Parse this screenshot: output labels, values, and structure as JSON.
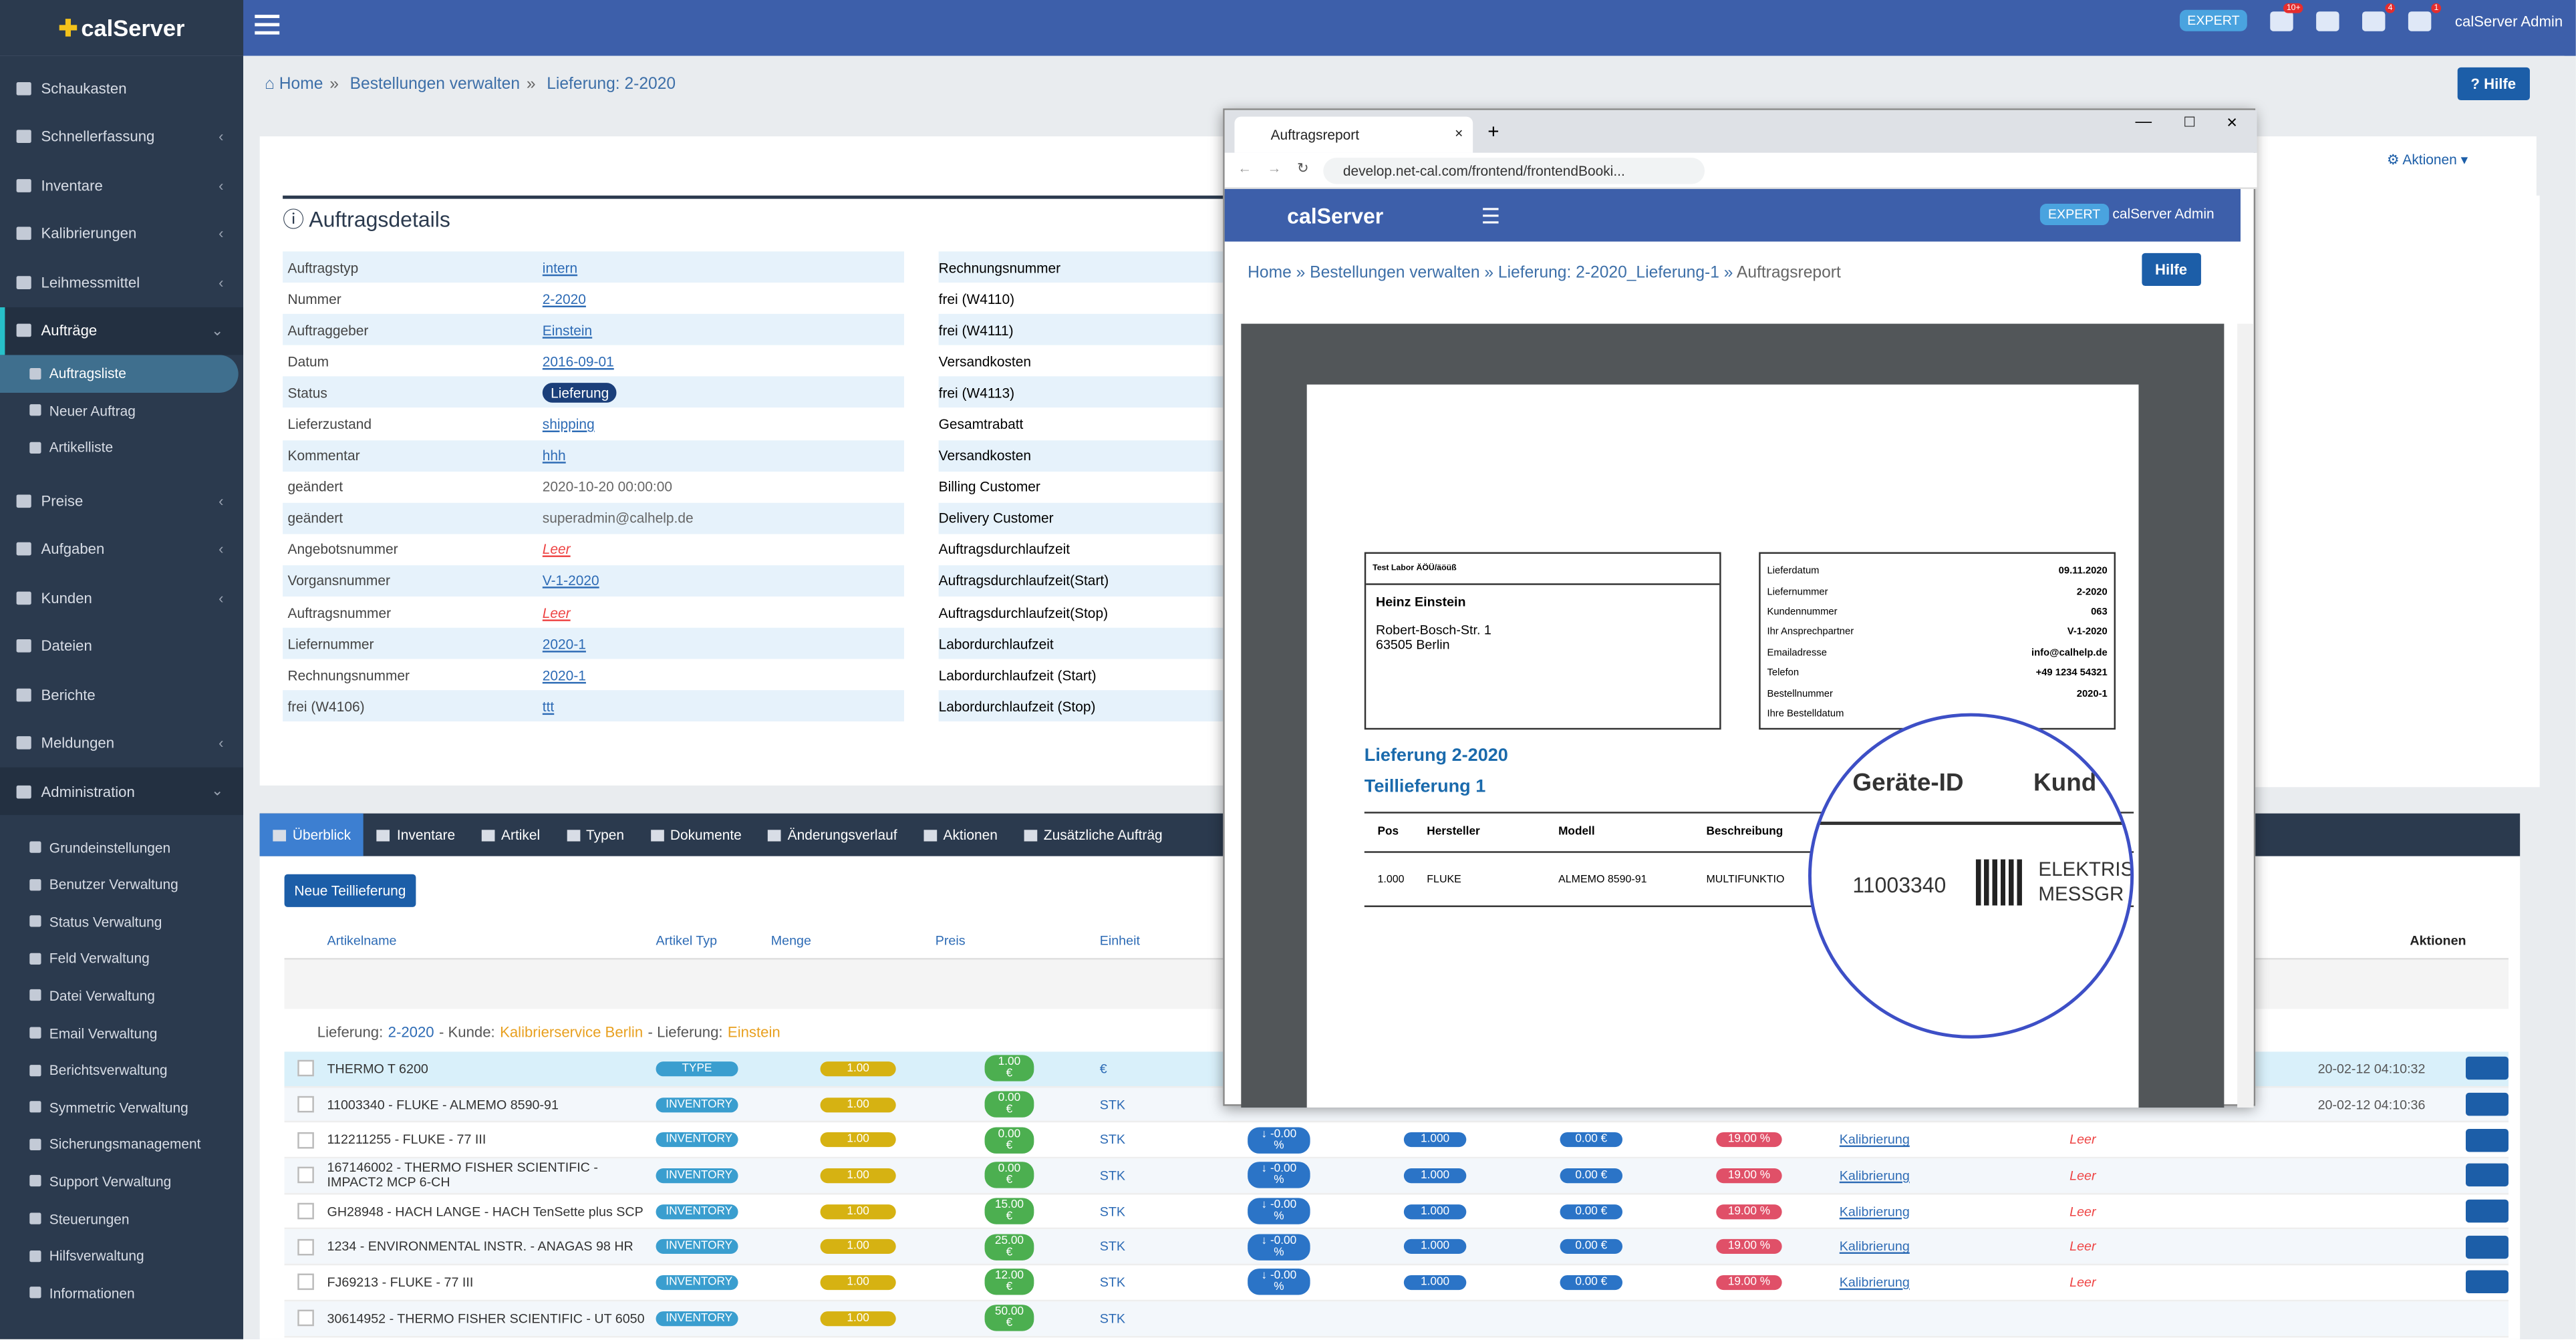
{
  "app": {
    "name": "calServer"
  },
  "topbar": {
    "expert": "EXPERT",
    "user": "calServer Admin",
    "badges": [
      "10+",
      "4",
      "1"
    ]
  },
  "sidebar": {
    "items": [
      "Schaukasten",
      "Schnellerfassung",
      "Inventare",
      "Kalibrierungen",
      "Leihmessmittel",
      "Aufträge"
    ],
    "auftraege_sub": [
      "Auftragsliste",
      "Neuer Auftrag",
      "Artikelliste"
    ],
    "items2": [
      "Preise",
      "Aufgaben",
      "Kunden",
      "Dateien",
      "Berichte",
      "Meldungen",
      "Administration"
    ],
    "admin_sub": [
      "Grundeinstellungen",
      "Benutzer Verwaltung",
      "Status Verwaltung",
      "Feld Verwaltung",
      "Datei Verwaltung",
      "Email Verwaltung",
      "Berichtsverwaltung",
      "Symmetric Verwaltung",
      "Sicherungsmanagement",
      "Support Verwaltung",
      "Steuerungen",
      "Hilfsverwaltung",
      "Informationen"
    ]
  },
  "breadcrumb": {
    "home": "Home",
    "b1": "Bestellungen verwalten",
    "b2": "Lieferung: 2-2020"
  },
  "hilfe": "Hilfe",
  "details": {
    "title": "Auftragsdetails",
    "left": [
      {
        "k": "Auftragstyp",
        "v": "intern"
      },
      {
        "k": "Nummer",
        "v": "2-2020"
      },
      {
        "k": "Auftraggeber",
        "v": "Einstein"
      },
      {
        "k": "Datum",
        "v": "2016-09-01"
      },
      {
        "k": "Status",
        "v": "Lieferung"
      },
      {
        "k": "Lieferzustand",
        "v": "shipping"
      },
      {
        "k": "Kommentar",
        "v": "hhh"
      },
      {
        "k": "geändert",
        "v": "2020-10-20 00:00:00"
      },
      {
        "k": "geändert",
        "v": "superadmin@calhelp.de"
      },
      {
        "k": "Angebotsnummer",
        "v": "Leer"
      },
      {
        "k": "Vorgansnummer",
        "v": "V-1-2020"
      },
      {
        "k": "Auftragsnummer",
        "v": "Leer"
      },
      {
        "k": "Liefernummer",
        "v": "2020-1"
      },
      {
        "k": "Rechnungsnummer",
        "v": "2020-1"
      },
      {
        "k": "frei (W4106)",
        "v": "ttt"
      }
    ],
    "right": [
      "Rechnungsnummer",
      "frei (W4110)",
      "frei (W4111)",
      "Versandkosten",
      "frei (W4113)",
      "Gesamtrabatt",
      "Versandkosten",
      "Billing Customer",
      "Delivery Customer",
      "Auftragsdurchlaufzeit",
      "Auftragsdurchlaufzeit(Start)",
      "Auftragsdurchlaufzeit(Stop)",
      "Labordurchlaufzeit",
      "Labordurchlaufzeit (Start)",
      "Labordurchlaufzeit (Stop)"
    ]
  },
  "tabs": [
    "Überblick",
    "Inventare",
    "Artikel",
    "Typen",
    "Dokumente",
    "Änderungsverlauf",
    "Aktionen",
    "Zusätzliche Aufträg"
  ],
  "neu": "Neue Teillieferung",
  "cols": [
    "Artikelname",
    "Artikel Typ",
    "Menge",
    "Preis",
    "Einheit"
  ],
  "aktionen": "Aktionen",
  "lief": {
    "p1": "Lieferung:",
    "no": "2-2020",
    "p2": "- Kunde:",
    "kunde": "Kalibrierservice Berlin",
    "p3": "- Lieferung:",
    "wer": "Einstein"
  },
  "rows": [
    {
      "name": "THERMO T 6200",
      "type": "TYPE",
      "menge": "1.00",
      "preis": "1.00 €",
      "einheit": "€"
    },
    {
      "name": "11003340 - FLUKE - ALMEMO 8590-91",
      "type": "INVENTORY",
      "menge": "1.00",
      "preis": "0.00 €",
      "einheit": "STK"
    },
    {
      "name": "112211255 - FLUKE - 77 III",
      "type": "INVENTORY",
      "menge": "1.00",
      "preis": "0.00 €",
      "einheit": "STK"
    },
    {
      "name": "167146002 - THERMO FISHER SCIENTIFIC - IMPACT2 MCP 6-CH",
      "type": "INVENTORY",
      "menge": "1.00",
      "preis": "0.00 €",
      "einheit": "STK"
    },
    {
      "name": "GH28948 - HACH LANGE - HACH TenSette plus SCP",
      "type": "INVENTORY",
      "menge": "1.00",
      "preis": "15.00 €",
      "einheit": "STK"
    },
    {
      "name": "1234 - ENVIRONMENTAL INSTR. - ANAGAS 98 HR",
      "type": "INVENTORY",
      "menge": "1.00",
      "preis": "25.00 €",
      "einheit": "STK"
    },
    {
      "name": "FJ69213 - FLUKE - 77 III",
      "type": "INVENTORY",
      "menge": "1.00",
      "preis": "12.00 €",
      "einheit": "STK"
    },
    {
      "name": "30614952 - THERMO FISHER SCIENTIFIC - UT 6050",
      "type": "INVENTORY",
      "menge": "1.00",
      "preis": "50.00 €",
      "einheit": "STK"
    }
  ],
  "rowextra": {
    "rabatt": "↓ -0.00 %",
    "val": "1.000",
    "ship": "0.00 €",
    "tax": "19.00 %",
    "kal": "Kalibrierung",
    "leer": "Leer",
    "dt1": "20-02-12 04:10:32",
    "dt2": "20-02-12 04:10:36"
  },
  "popup": {
    "tab": "Auftragsreport",
    "url": "develop.net-cal.com/frontend/frontendBooki...",
    "expert": "EXPERT",
    "user": "calServer Admin",
    "bc": [
      "Home",
      "Bestellungen verwalten",
      "Lieferung: 2-2020_Lieferung-1",
      "Auftragsreport"
    ],
    "hilfe": "Hilfe",
    "doc": {
      "sender": "Test Labor ÄÖÜ/äöüß",
      "name": "Heinz Einstein",
      "street": "Robert-Bosch-Str. 1",
      "city": "63505 Berlin",
      "info": [
        {
          "k": "Lieferdatum",
          "v": "09.11.2020"
        },
        {
          "k": "Liefernummer",
          "v": "2-2020"
        },
        {
          "k": "Kundennummer",
          "v": "063"
        },
        {
          "k": "Ihr Ansprechpartner",
          "v": "V-1-2020"
        },
        {
          "k": "Emailadresse",
          "v": "info@calhelp.de"
        },
        {
          "k": "Telefon",
          "v": "+49 1234 54321"
        },
        {
          "k": "Bestellnummer",
          "v": "2020-1"
        },
        {
          "k": "Ihre Bestelldatum",
          "v": ""
        }
      ],
      "t1": "Lieferung 2-2020",
      "t2": "Teillieferung 1",
      "head": [
        "Pos",
        "Hersteller",
        "Modell",
        "Beschreibung"
      ],
      "row": [
        "1.000",
        "FLUKE",
        "ALMEMO 8590-91",
        "MULTIFUNKTIO"
      ],
      "mag": {
        "h1": "Geräte-ID",
        "h2": "Kund",
        "id": "11003340",
        "e1": "ELEKTRIS",
        "e2": "MESSGR"
      }
    }
  }
}
